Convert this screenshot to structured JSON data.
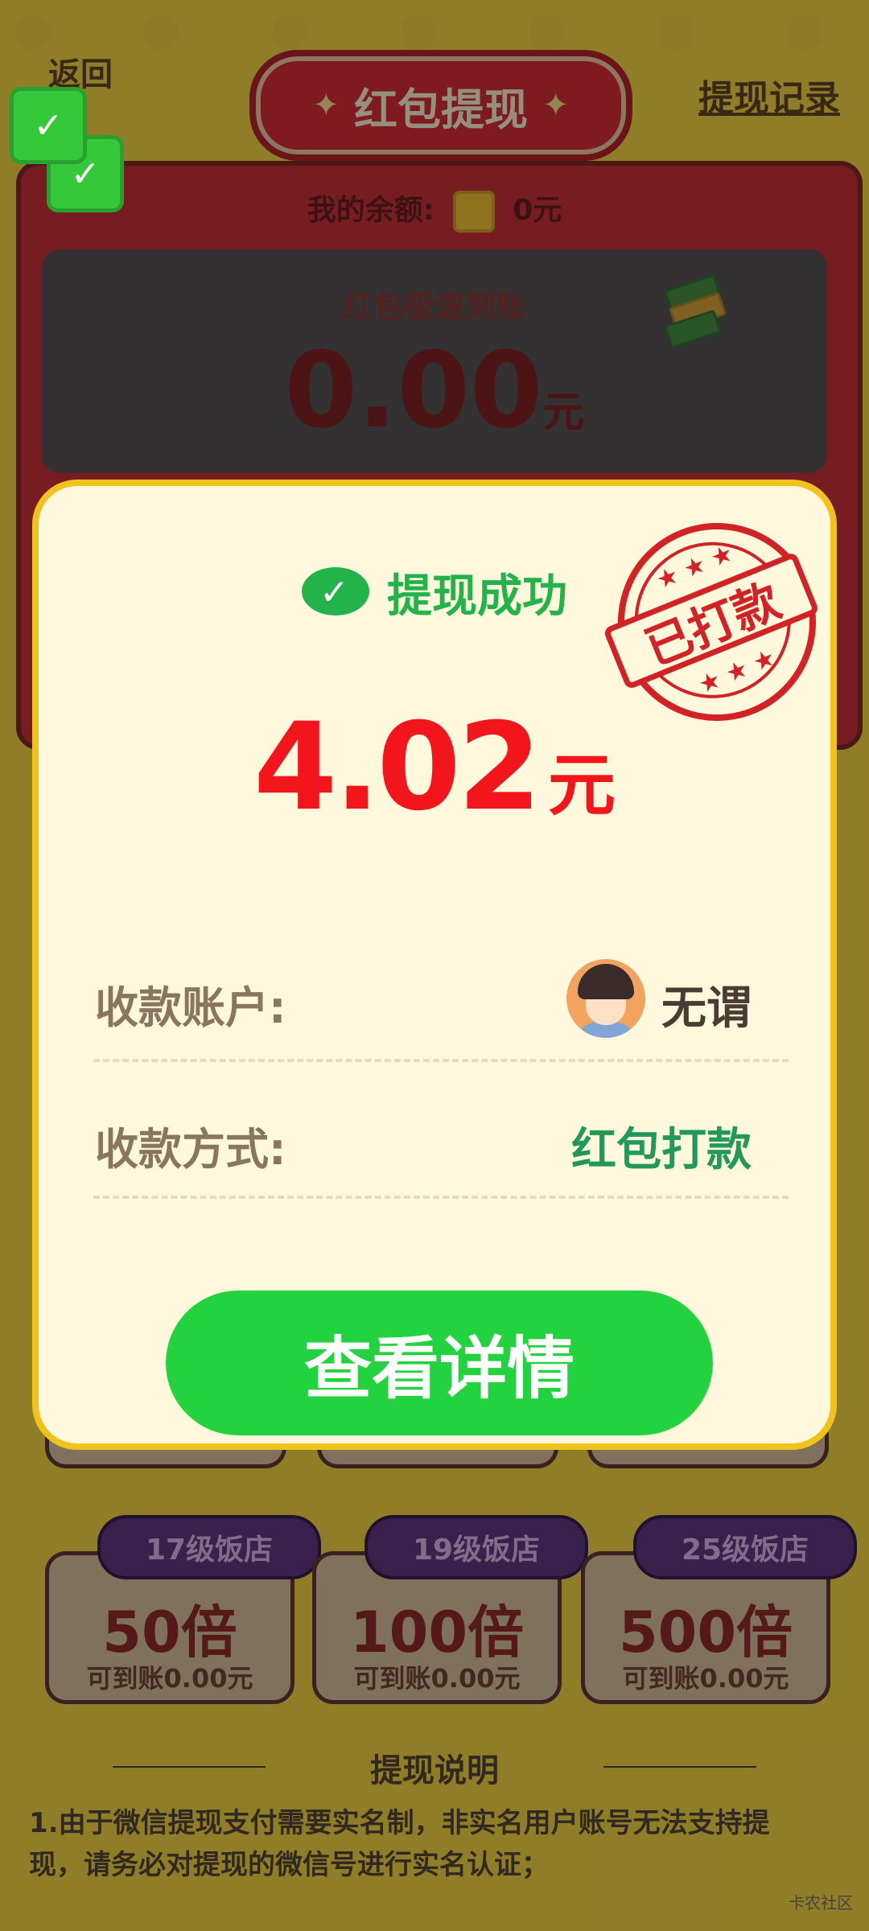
{
  "header": {
    "back_label": "返回",
    "title": "红包提现",
    "record_label": "提现记录"
  },
  "balance": {
    "label": "我的余额:",
    "value": "0元"
  },
  "speed_card": {
    "title": "红包极速到账",
    "amount": "0.00",
    "unit": "元"
  },
  "modal": {
    "status_text": "提现成功",
    "stamp_text": "已打款",
    "amount": "4.02",
    "unit": "元",
    "account_label": "收款账户:",
    "account_name": "无谓",
    "method_label": "收款方式:",
    "method_value": "红包打款",
    "detail_button": "查看详情"
  },
  "tiers": [
    {
      "tag": "17级饭店",
      "multiplier": "50倍",
      "amount": "可到账0.00元"
    },
    {
      "tag": "19级饭店",
      "multiplier": "100倍",
      "amount": "可到账0.00元"
    },
    {
      "tag": "25级饭店",
      "multiplier": "500倍",
      "amount": "可到账0.00元"
    }
  ],
  "explain": {
    "title": "提现说明",
    "line1": "1.由于微信提现支付需要实名制，非实名用户账号无法支持提",
    "line2": "现，请务必对提现的微信号进行实名认证；"
  },
  "watermark": "卡农社区",
  "colors": {
    "brand_red": "#d61f2b",
    "success_green": "#22b34a",
    "button_green": "#22d23e",
    "amount_red": "#f2151b",
    "modal_border": "#f1c21c"
  },
  "icons": [
    "wechat-icon",
    "coin-icon",
    "money-stack-icon",
    "star-icon",
    "checkmark-icon"
  ]
}
